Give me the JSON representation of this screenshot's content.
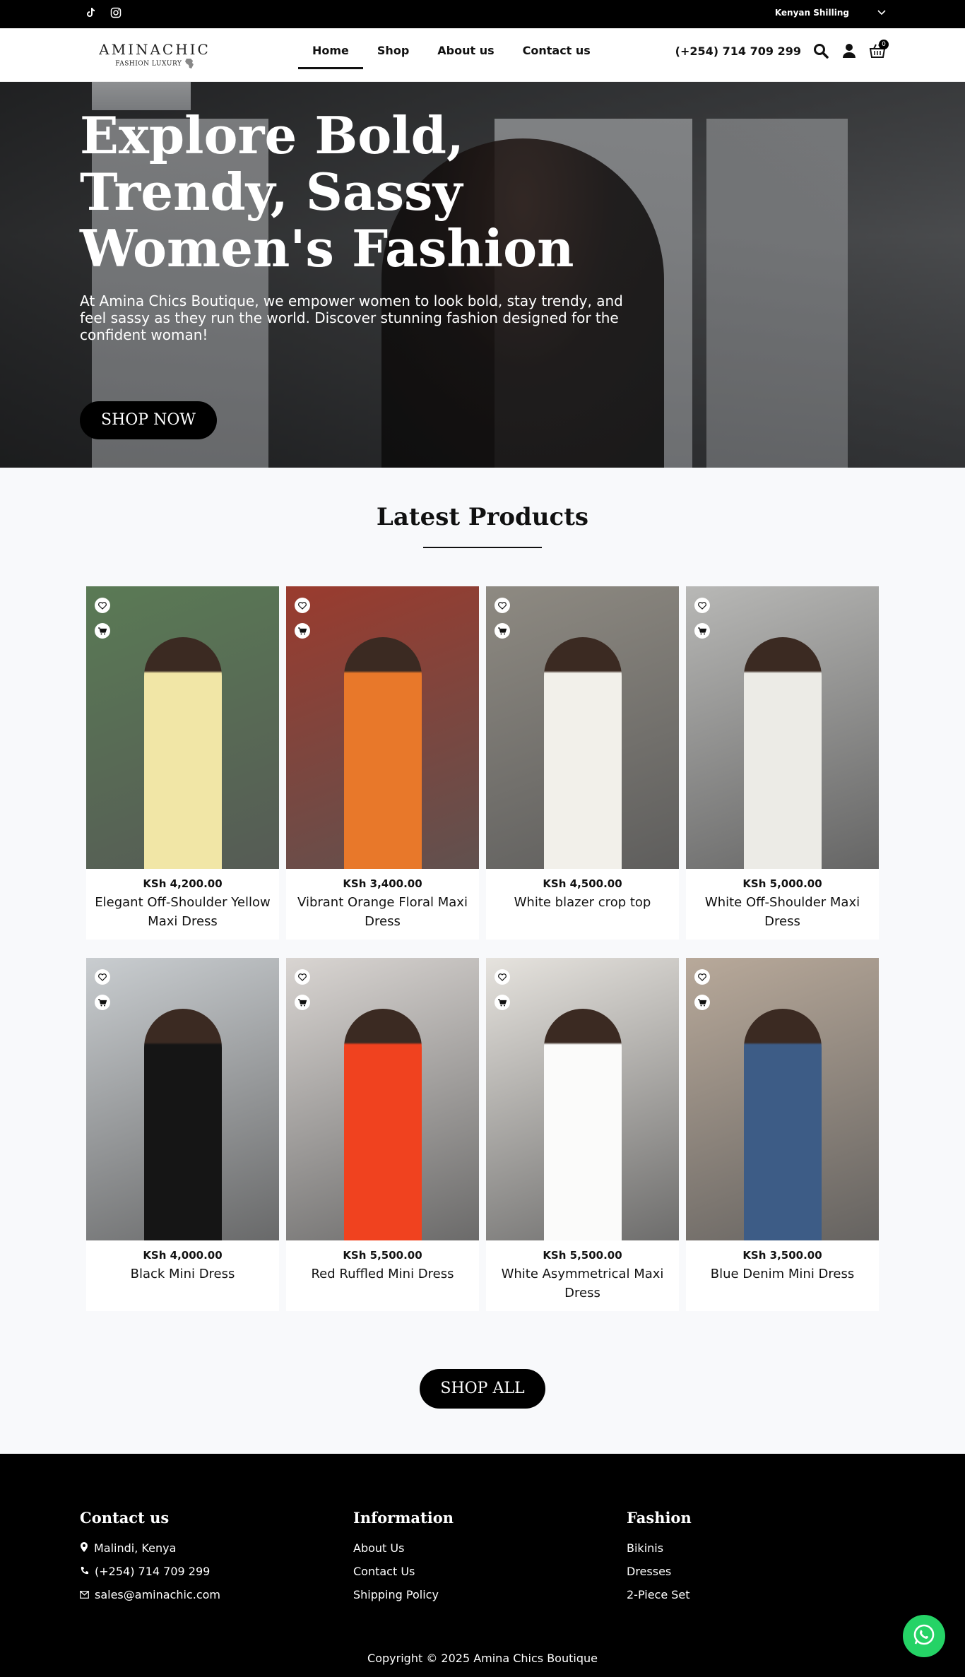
{
  "topbar": {
    "social_icons": [
      "tiktok-icon",
      "instagram-icon"
    ],
    "currency": "Kenyan Shilling"
  },
  "header": {
    "logo": {
      "brand": "AMINACHIC",
      "tagline": "FASHION LUXURY"
    },
    "nav": [
      {
        "label": "Home",
        "active": true
      },
      {
        "label": "Shop",
        "active": false
      },
      {
        "label": "About us",
        "active": false
      },
      {
        "label": "Contact us",
        "active": false
      }
    ],
    "phone": "(+254) 714 709 299",
    "cart_count": "0"
  },
  "hero": {
    "title": "Explore Bold, Trendy, Sassy Women's Fashion",
    "subtitle": "At Amina Chics Boutique, we empower women to look bold, stay trendy, and feel sassy as they run the world. Discover stunning fashion designed for the confident woman!",
    "cta": "SHOP NOW"
  },
  "products": {
    "title": "Latest Products",
    "items": [
      {
        "price": "KSh 4,200.00",
        "name": "Elegant Off-Shoulder Yellow Maxi Dress",
        "bg": "#5a7a55",
        "dress": "#f1e6a6"
      },
      {
        "price": "KSh 3,400.00",
        "name": "Vibrant Orange Floral Maxi Dress",
        "bg": "#9a3b2e",
        "dress": "#e8782a"
      },
      {
        "price": "KSh 4,500.00",
        "name": "White blazer crop top",
        "bg": "#8e8a82",
        "dress": "#f2f0ea"
      },
      {
        "price": "KSh 5,000.00",
        "name": "White Off-Shoulder Maxi Dress",
        "bg": "#b8b8b6",
        "dress": "#ecebe6"
      },
      {
        "price": "KSh 4,000.00",
        "name": "Black Mini Dress",
        "bg": "#c9cdd0",
        "dress": "#151515"
      },
      {
        "price": "KSh 5,500.00",
        "name": "Red Ruffled Mini Dress",
        "bg": "#d9d5d2",
        "dress": "#f0421f"
      },
      {
        "price": "KSh 5,500.00",
        "name": "White Asymmetrical Maxi Dress",
        "bg": "#e6e3de",
        "dress": "#fbfbfa"
      },
      {
        "price": "KSh 3,500.00",
        "name": "Blue Denim Mini Dress",
        "bg": "#b8a99a",
        "dress": "#3d5c86"
      }
    ],
    "shop_all": "SHOP ALL"
  },
  "footer": {
    "contact": {
      "title": "Contact us",
      "location": "Malindi, Kenya",
      "phone": "(+254) 714 709 299",
      "email": "sales@aminachic.com"
    },
    "information": {
      "title": "Information",
      "links": [
        "About Us",
        "Contact Us",
        "Shipping Policy"
      ]
    },
    "fashion": {
      "title": "Fashion",
      "links": [
        "Bikinis",
        "Dresses",
        "2-Piece Set"
      ]
    },
    "copyright": "Copyright © 2025 Amina Chics Boutique"
  }
}
